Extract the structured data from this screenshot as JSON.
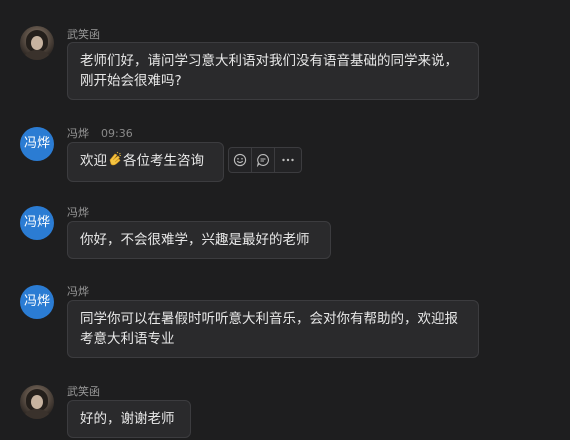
{
  "messages": [
    {
      "sender": "武笑函",
      "time": "",
      "text": "老师们好，请问学习意大利语对我们没有语音基础的同学来说，刚开始会很难吗?"
    },
    {
      "sender": "冯烨",
      "avatar_text": "冯烨",
      "time": "09:36",
      "text_before": "欢迎",
      "emoji": "clapping-hands",
      "text_after": "各位考生咨询"
    },
    {
      "sender": "冯烨",
      "avatar_text": "冯烨",
      "time": "",
      "text": "你好，不会很难学，兴趣是最好的老师"
    },
    {
      "sender": "冯烨",
      "avatar_text": "冯烨",
      "time": "",
      "text": "同学你可以在暑假时听听意大利音乐，会对你有帮助的，欢迎报考意大利语专业"
    },
    {
      "sender": "武笑函",
      "time": "",
      "text": "好的，谢谢老师"
    }
  ],
  "hover_actions": [
    {
      "icon": "emoji-smile-icon"
    },
    {
      "icon": "reply-bubble-icon"
    },
    {
      "icon": "more-options-icon"
    }
  ],
  "colors": {
    "background": "#1e1e1f",
    "bubble": "#2a2a2c",
    "bubble_border": "#3c3c3f",
    "avatar_blue": "#2b7cd3",
    "meta_text": "#9a9a9a"
  }
}
